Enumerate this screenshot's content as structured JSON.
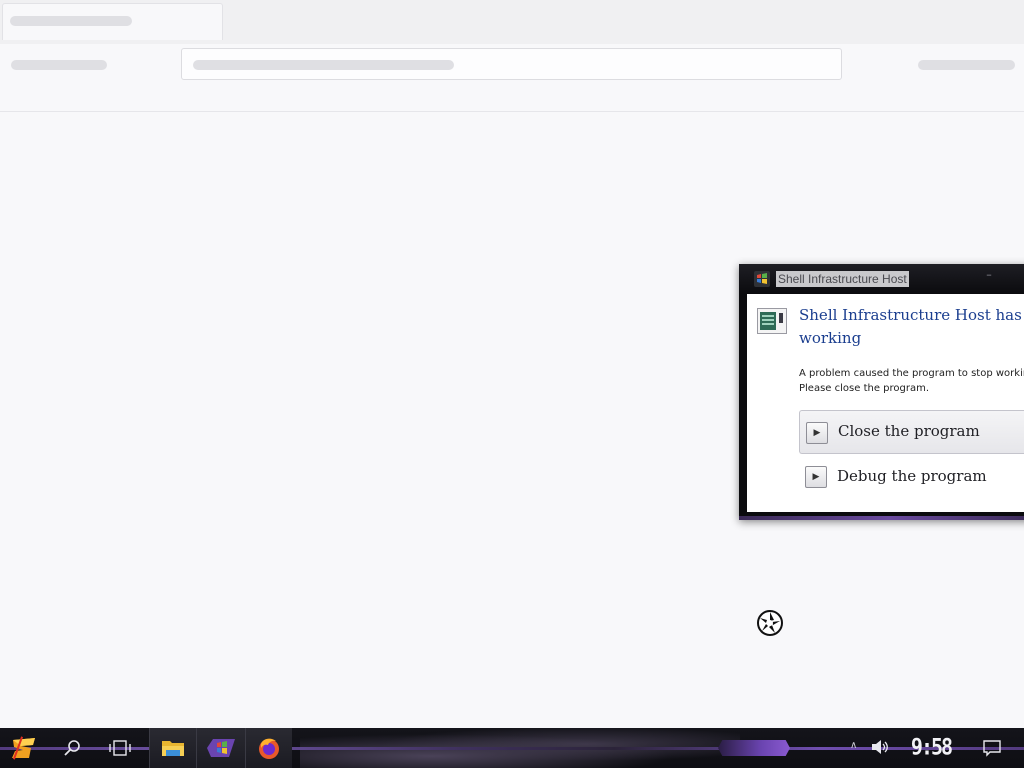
{
  "dialog": {
    "title": "Shell Infrastructure Host",
    "minimize_glyph": "–",
    "heading_line1": "Shell Infrastructure Host has s",
    "heading_line2": "working",
    "message_line1": "A problem caused the program to stop workin",
    "message_line2": "Please close the program.",
    "primary_action": "Close the program",
    "secondary_action": "Debug the program",
    "arrow_glyph": "▶"
  },
  "taskbar": {
    "clock": "9:58 AM",
    "tray_chevron": "∧",
    "pinned_apps": [
      "start",
      "search",
      "task-view",
      "file-explorer",
      "app-window",
      "firefox"
    ]
  },
  "colors": {
    "accent_purple": "#6a44b0",
    "heading_blue": "#1b3e8f",
    "taskbar_bg": "#0e0e13",
    "page_bg": "#f8f8fa"
  }
}
